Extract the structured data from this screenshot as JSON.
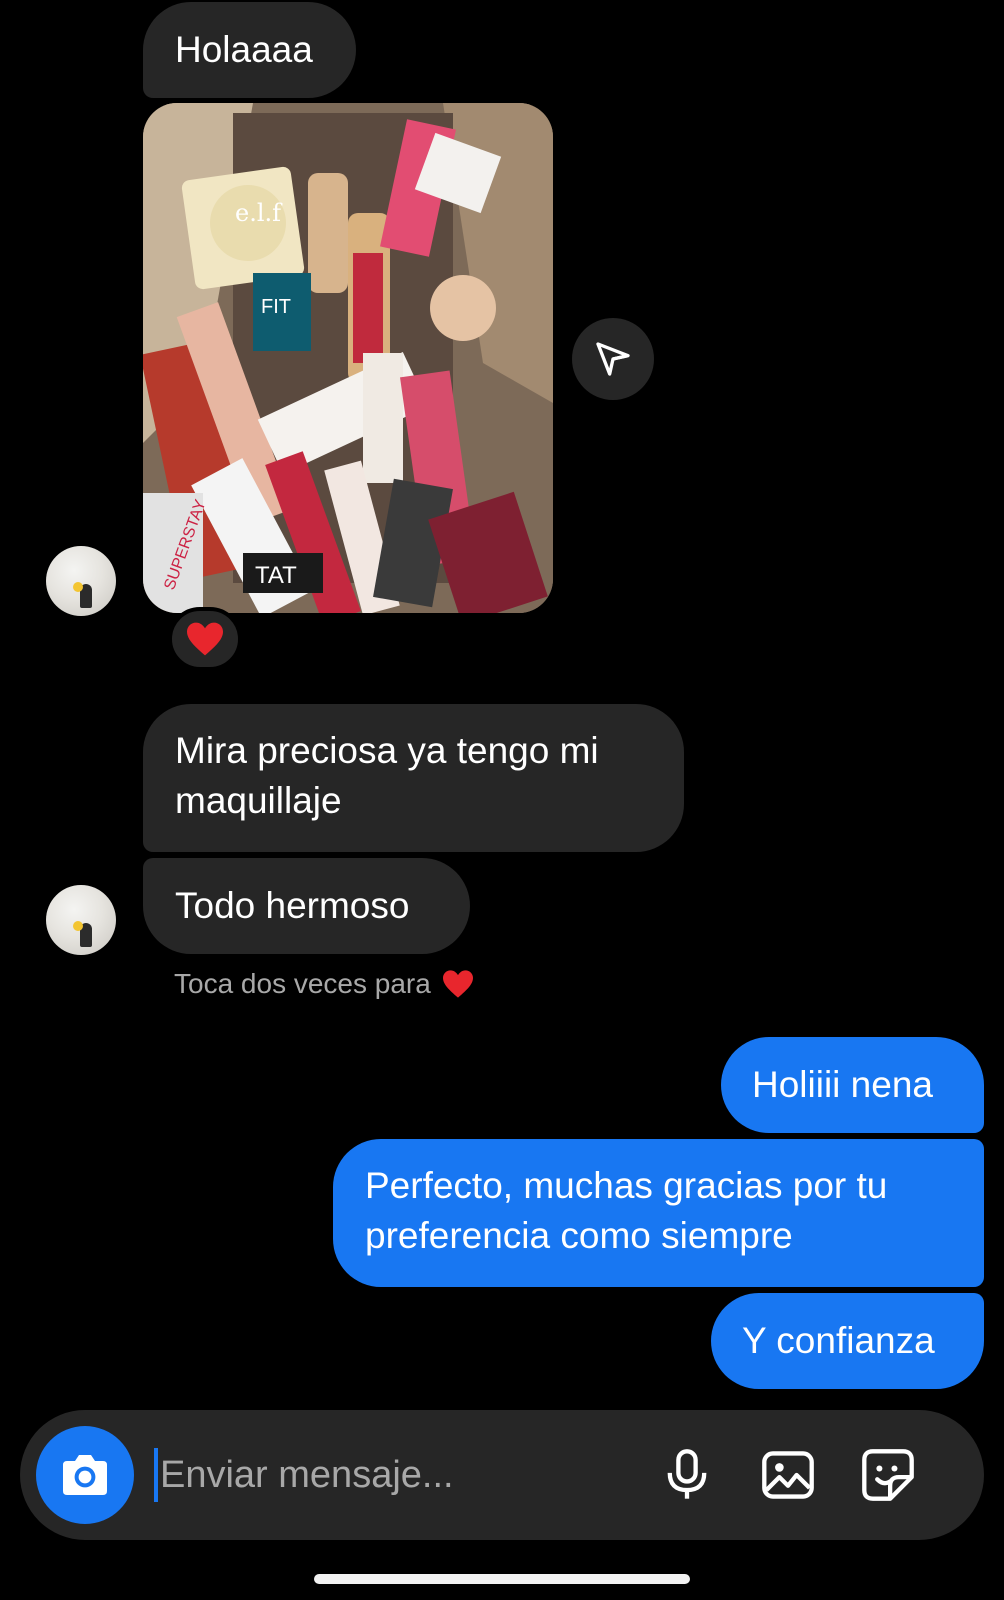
{
  "messages": {
    "incoming": {
      "m1": "Holaaaa",
      "m2_line1": "Mira preciosa ya tengo mi",
      "m2_line2": "maquillaje",
      "m3": "Todo hermoso"
    },
    "outgoing": {
      "m1": "Holiiii nena",
      "m2_line1": "Perfecto, muchas gracias por tu",
      "m2_line2": "preferencia como siempre",
      "m3": "Y confianza"
    }
  },
  "photo_labels": {
    "elf": "e.l.f",
    "fit": "FIT",
    "tat": "TAT",
    "super": "SUPERSTAY"
  },
  "reaction": "❤",
  "hint": {
    "text": "Toca dos veces para",
    "heart": "❤"
  },
  "composer": {
    "placeholder": "Enviar mensaje..."
  },
  "icons": {
    "camera": "camera-icon",
    "mic": "microphone-icon",
    "gallery": "gallery-icon",
    "sticker": "sticker-icon",
    "share": "send-icon"
  },
  "colors": {
    "background": "#000000",
    "incoming_bubble": "#262626",
    "outgoing_bubble": "#1877f2",
    "heart": "#e8262d",
    "hint_text": "#a8a8a8"
  }
}
